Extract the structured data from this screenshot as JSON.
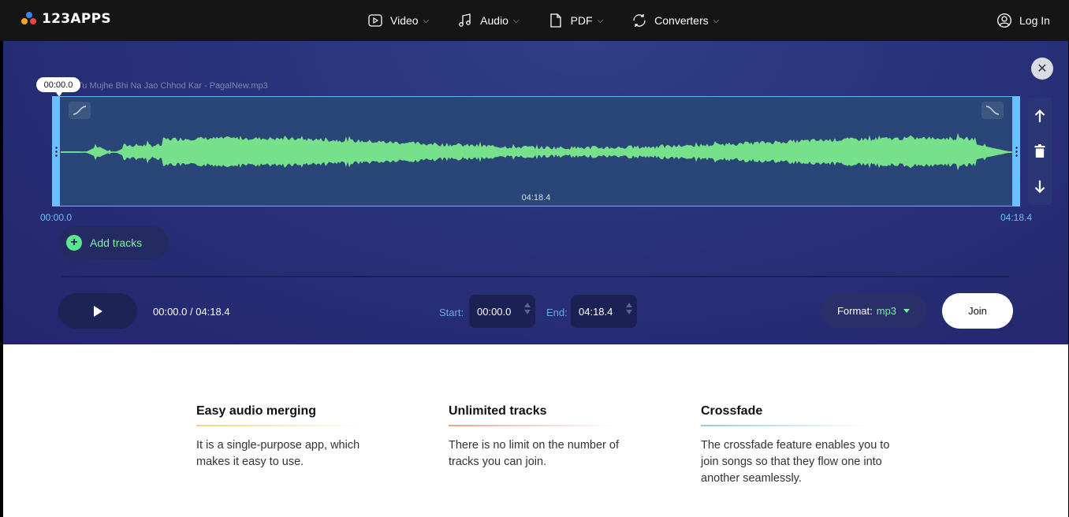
{
  "header": {
    "logo_text": "123APPS",
    "nav": [
      {
        "label": "Video",
        "icon": "video-icon"
      },
      {
        "label": "Audio",
        "icon": "music-note-icon"
      },
      {
        "label": "PDF",
        "icon": "document-icon"
      },
      {
        "label": "Converters",
        "icon": "convert-icon"
      }
    ],
    "login_label": "Log In"
  },
  "editor": {
    "track": {
      "file_name": "Tu Mujhe Bhi Na Jao Chhod Kar - PagalNew.mp3",
      "cursor_time": "00:00.0",
      "duration": "04:18.4"
    },
    "ruler": {
      "start": "00:00.0",
      "end": "04:18.4"
    },
    "add_tracks_label": "Add tracks",
    "player": {
      "time_display": "00:00.0 / 04:18.4"
    },
    "start": {
      "label": "Start:",
      "value": "00:00.0"
    },
    "end": {
      "label": "End:",
      "value": "04:18.4"
    },
    "format": {
      "label": "Format:",
      "value": "mp3"
    },
    "join_label": "Join"
  },
  "colors": {
    "accent_green": "#7ef0a2",
    "wave": "#76e08a",
    "handle": "#6bc1ff",
    "editor_bg": "#28327a"
  },
  "features": [
    {
      "title": "Easy audio merging",
      "text": "It is a single-purpose app, which makes it easy to use."
    },
    {
      "title": "Unlimited tracks",
      "text": "There is no limit on the number of tracks you can join."
    },
    {
      "title": "Crossfade",
      "text": "The crossfade feature enables you to join songs so that they flow one into another seamlessly."
    }
  ]
}
